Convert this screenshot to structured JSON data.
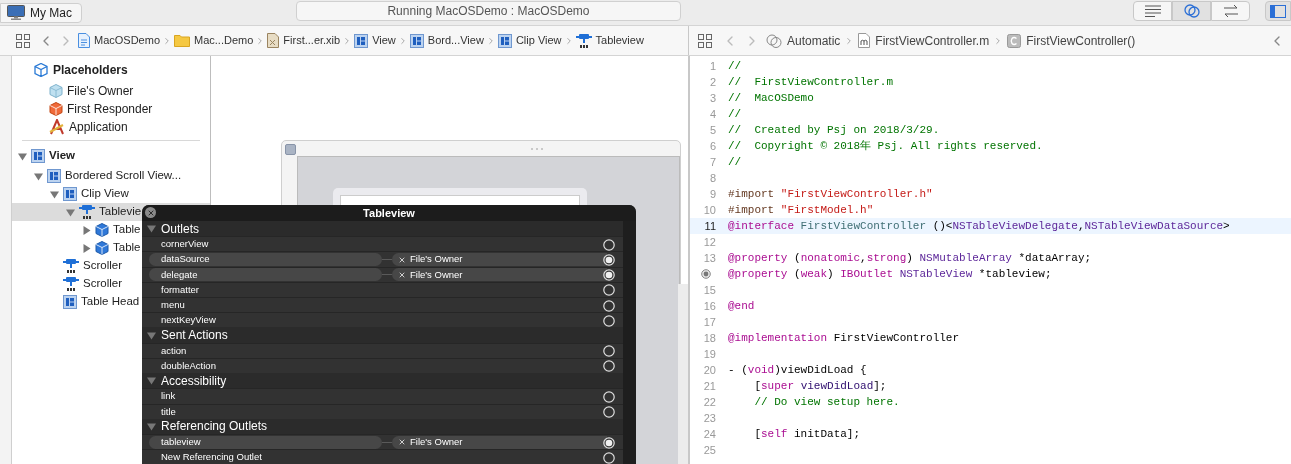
{
  "toolbar": {
    "scheme_target": "My Mac",
    "status": "Running MacOSDemo : MacOSDemo",
    "editor_modes": [
      {
        "kind": "lines",
        "selected": false
      },
      {
        "kind": "circles",
        "selected": true
      },
      {
        "kind": "arrows",
        "selected": false
      }
    ],
    "panel_toggle": {
      "selected": true
    }
  },
  "ib_jump_bar": {
    "crumbs": [
      {
        "label": "MacOSDemo",
        "kind": "project"
      },
      {
        "label": "Mac...Demo",
        "kind": "folder"
      },
      {
        "label": "First...er.xib",
        "kind": "xib"
      },
      {
        "label": "View",
        "kind": "view"
      },
      {
        "label": "Bord...View",
        "kind": "view"
      },
      {
        "label": "Clip View",
        "kind": "view"
      },
      {
        "label": "Tableview",
        "kind": "table"
      }
    ]
  },
  "code_jump_bar": {
    "crumbs": [
      {
        "label": "Automatic",
        "kind": "circles"
      },
      {
        "label": "FirstViewController.m",
        "kind": "mfile"
      },
      {
        "label": "FirstViewController()",
        "kind": "class"
      }
    ]
  },
  "outline": {
    "placeholders": {
      "label": "Placeholders",
      "items": [
        {
          "label": "File's Owner",
          "kind": "owner"
        },
        {
          "label": "First Responder",
          "kind": "responder"
        },
        {
          "label": "Application",
          "kind": "app"
        }
      ]
    },
    "tree": [
      {
        "label": "View",
        "kind": "view",
        "expanded": true,
        "selected": false,
        "children": [
          {
            "label": "Bordered Scroll View...",
            "kind": "view",
            "expanded": true,
            "selected": false,
            "children": [
              {
                "label": "Clip View",
                "kind": "view",
                "expanded": true,
                "selected": false,
                "children": [
                  {
                    "label": "Tablevie",
                    "kind": "table",
                    "expanded": true,
                    "selected": true,
                    "children": [
                      {
                        "label": "Table",
                        "kind": "cube",
                        "expanded": false,
                        "selected": false
                      },
                      {
                        "label": "Table",
                        "kind": "cube",
                        "expanded": false,
                        "selected": false
                      }
                    ]
                  }
                ]
              },
              {
                "label": "Scroller",
                "kind": "table",
                "selected": false
              },
              {
                "label": "Scroller",
                "kind": "table",
                "selected": false
              },
              {
                "label": "Table Head",
                "kind": "view",
                "selected": false
              }
            ]
          }
        ]
      }
    ]
  },
  "connections_panel": {
    "title": "Tableview",
    "sections": [
      {
        "label": "Outlets",
        "expanded": true,
        "items": [
          {
            "name": "cornerView",
            "connected": false
          },
          {
            "name": "dataSource",
            "connected": true,
            "target": "File's Owner"
          },
          {
            "name": "delegate",
            "connected": true,
            "target": "File's Owner"
          },
          {
            "name": "formatter",
            "connected": false
          },
          {
            "name": "menu",
            "connected": false
          },
          {
            "name": "nextKeyView",
            "connected": false
          }
        ]
      },
      {
        "label": "Sent Actions",
        "expanded": true,
        "items": [
          {
            "name": "action",
            "connected": false
          },
          {
            "name": "doubleAction",
            "connected": false
          }
        ]
      },
      {
        "label": "Accessibility",
        "expanded": true,
        "items": [
          {
            "name": "link",
            "connected": false
          },
          {
            "name": "title",
            "connected": false
          }
        ]
      },
      {
        "label": "Referencing Outlets",
        "expanded": true,
        "items": [
          {
            "name": "tableview",
            "connected": true,
            "target": "File's Owner"
          },
          {
            "name": "New Referencing Outlet",
            "connected": false
          }
        ]
      }
    ]
  },
  "code": {
    "lines": [
      {
        "kind": "numbered",
        "number": "1",
        "current": false,
        "tokens": [
          {
            "kind": "comment",
            "text": "//"
          }
        ]
      },
      {
        "kind": "numbered",
        "number": "2",
        "current": false,
        "tokens": [
          {
            "kind": "comment",
            "text": "//  FirstViewController.m"
          }
        ]
      },
      {
        "kind": "numbered",
        "number": "3",
        "current": false,
        "tokens": [
          {
            "kind": "comment",
            "text": "//  MacOSDemo"
          }
        ]
      },
      {
        "kind": "numbered",
        "number": "4",
        "current": false,
        "tokens": [
          {
            "kind": "comment",
            "text": "//"
          }
        ]
      },
      {
        "kind": "numbered",
        "number": "5",
        "current": false,
        "tokens": [
          {
            "kind": "comment",
            "text": "//  Created by Psj on 2018/3/29."
          }
        ]
      },
      {
        "kind": "numbered",
        "number": "6",
        "current": false,
        "tokens": [
          {
            "kind": "comment",
            "text": "//  Copyright © 2018年 Psj. All rights reserved."
          }
        ]
      },
      {
        "kind": "numbered",
        "number": "7",
        "current": false,
        "tokens": [
          {
            "kind": "comment",
            "text": "//"
          }
        ]
      },
      {
        "kind": "numbered",
        "number": "8",
        "current": false
      },
      {
        "kind": "numbered",
        "number": "9",
        "current": false,
        "tokens": [
          {
            "kind": "directive",
            "text": "#import "
          },
          {
            "kind": "string",
            "text": "\"FirstViewController.h\""
          }
        ]
      },
      {
        "kind": "numbered",
        "number": "10",
        "current": false,
        "tokens": [
          {
            "kind": "directive",
            "text": "#import "
          },
          {
            "kind": "string",
            "text": "\"FirstModel.h\""
          }
        ]
      },
      {
        "kind": "numbered",
        "number": "11",
        "current": true,
        "tokens": [
          {
            "kind": "keyword",
            "text": "@interface"
          },
          {
            "kind": "ident",
            "text": " FirstViewController"
          },
          {
            "kind": "plain",
            "text": " ()<"
          },
          {
            "kind": "type",
            "text": "NSTableViewDelegate"
          },
          {
            "kind": "plain",
            "text": ","
          },
          {
            "kind": "type",
            "text": "NSTableViewDataSource"
          },
          {
            "kind": "plain",
            "text": ">"
          }
        ]
      },
      {
        "kind": "numbered",
        "number": "12",
        "current": false
      },
      {
        "kind": "numbered",
        "number": "13",
        "current": false,
        "tokens": [
          {
            "kind": "keyword",
            "text": "@property"
          },
          {
            "kind": "plain",
            "text": " ("
          },
          {
            "kind": "keyword",
            "text": "nonatomic"
          },
          {
            "kind": "plain",
            "text": ","
          },
          {
            "kind": "keyword",
            "text": "strong"
          },
          {
            "kind": "plain",
            "text": ") "
          },
          {
            "kind": "type",
            "text": "NSMutableArray"
          },
          {
            "kind": "plain",
            "text": " *dataArray;"
          }
        ]
      },
      {
        "kind": "outlet",
        "current": false,
        "tokens": [
          {
            "kind": "keyword",
            "text": "@property"
          },
          {
            "kind": "plain",
            "text": " ("
          },
          {
            "kind": "keyword",
            "text": "weak"
          },
          {
            "kind": "plain",
            "text": ") "
          },
          {
            "kind": "keyword",
            "text": "IBOutlet"
          },
          {
            "kind": "type",
            "text": " NSTableView"
          },
          {
            "kind": "plain",
            "text": " *tableview;"
          }
        ]
      },
      {
        "kind": "numbered",
        "number": "15",
        "current": false
      },
      {
        "kind": "numbered",
        "number": "16",
        "current": false,
        "tokens": [
          {
            "kind": "keyword",
            "text": "@end"
          }
        ]
      },
      {
        "kind": "numbered",
        "number": "17",
        "current": false
      },
      {
        "kind": "numbered",
        "number": "18",
        "current": false,
        "tokens": [
          {
            "kind": "keyword",
            "text": "@implementation"
          },
          {
            "kind": "plain",
            "text": " FirstViewController"
          }
        ]
      },
      {
        "kind": "numbered",
        "number": "19",
        "current": false
      },
      {
        "kind": "numbered",
        "number": "20",
        "current": false,
        "tokens": [
          {
            "kind": "plain",
            "text": "- ("
          },
          {
            "kind": "keyword",
            "text": "void"
          },
          {
            "kind": "plain",
            "text": ")viewDidLoad {"
          }
        ]
      },
      {
        "kind": "numbered",
        "number": "21",
        "current": false,
        "tokens": [
          {
            "kind": "plain",
            "text": "    ["
          },
          {
            "kind": "keyword",
            "text": "super"
          },
          {
            "kind": "method",
            "text": " viewDidLoad"
          },
          {
            "kind": "plain",
            "text": "];"
          }
        ]
      },
      {
        "kind": "numbered",
        "number": "22",
        "current": false,
        "tokens": [
          {
            "kind": "comment",
            "text": "    // Do view setup here."
          }
        ]
      },
      {
        "kind": "numbered",
        "number": "23",
        "current": false
      },
      {
        "kind": "numbered",
        "number": "24",
        "current": false,
        "tokens": [
          {
            "kind": "plain",
            "text": "    ["
          },
          {
            "kind": "keyword",
            "text": "self"
          },
          {
            "kind": "plain",
            "text": " initData];"
          }
        ]
      },
      {
        "kind": "numbered",
        "number": "25",
        "current": false
      }
    ]
  }
}
